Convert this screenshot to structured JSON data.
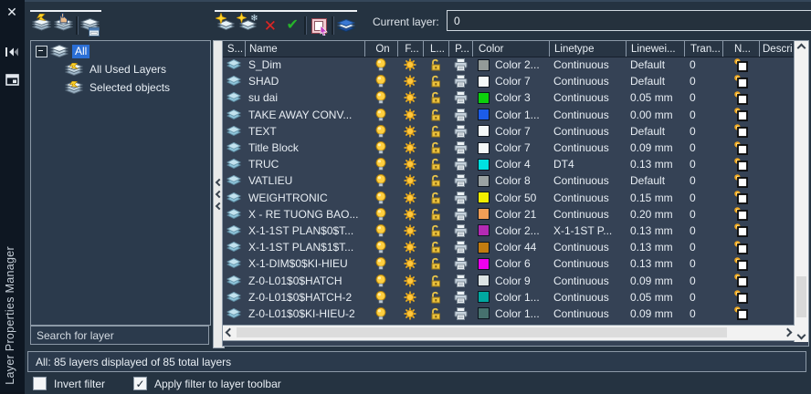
{
  "panel": {
    "title": "Layer Properties Manager",
    "accent_selection_color": "#2b6fd6"
  },
  "toolbar": {
    "left_icons": [
      "new-property-filter",
      "new-group-filter",
      "layer-states-manager"
    ],
    "right_icons": [
      "new-layer",
      "new-layer-vp-frozen",
      "delete-layer",
      "set-current",
      "select-layer",
      "layer-settings"
    ],
    "current_layer_label": "Current layer:",
    "current_layer_value": "0"
  },
  "side_icons": [
    "close-icon",
    "auto-hide-icon",
    "properties-menu-icon"
  ],
  "filters_tree": {
    "root": "All",
    "items": [
      "All Used Layers",
      "Selected objects"
    ]
  },
  "search": {
    "placeholder": "Search for layer"
  },
  "status_bar": "All: 85 layers displayed of 85 total layers",
  "footer": {
    "invert_filter": "Invert filter",
    "invert_checked": false,
    "apply_filter": "Apply filter to layer toolbar",
    "apply_checked": true,
    "check_glyph": "✓"
  },
  "table": {
    "columns": [
      "S...",
      "Name",
      "On",
      "F...",
      "L...",
      "P...",
      "Color",
      "Linetype",
      "Linewei...",
      "Tran...",
      "N...",
      "Descri"
    ],
    "rows": [
      {
        "name": "S_Dim",
        "color": "Color 2...",
        "hex": "#939a98",
        "linetype": "Continuous",
        "lineweight": "Default",
        "transparency": "0"
      },
      {
        "name": "SHAD",
        "color": "Color 7",
        "hex": "#f4f8f8",
        "linetype": "Continuous",
        "lineweight": "Default",
        "transparency": "0"
      },
      {
        "name": "su dai",
        "color": "Color 3",
        "hex": "#0cd00c",
        "linetype": "Continuous",
        "lineweight": "0.05 mm",
        "transparency": "0"
      },
      {
        "name": "TAKE AWAY CONV...",
        "color": "Color 1...",
        "hex": "#1c5ce8",
        "linetype": "Continuous",
        "lineweight": "0.00 mm",
        "transparency": "0"
      },
      {
        "name": "TEXT",
        "color": "Color 7",
        "hex": "#f4f8f8",
        "linetype": "Continuous",
        "lineweight": "Default",
        "transparency": "0"
      },
      {
        "name": "Title Block",
        "color": "Color 7",
        "hex": "#f4f8f8",
        "linetype": "Continuous",
        "lineweight": "0.09 mm",
        "transparency": "0"
      },
      {
        "name": "TRUC",
        "color": "Color 4",
        "hex": "#00e0e0",
        "linetype": "DT4",
        "lineweight": "0.13 mm",
        "transparency": "0"
      },
      {
        "name": "VATLIEU",
        "color": "Color 8",
        "hex": "#9aa2a2",
        "linetype": "Continuous",
        "lineweight": "Default",
        "transparency": "0"
      },
      {
        "name": "WEIGHTRONIC",
        "color": "Color 50",
        "hex": "#f2ee00",
        "linetype": "Continuous",
        "lineweight": "0.15 mm",
        "transparency": "0"
      },
      {
        "name": "X - RE TUONG BAO...",
        "color": "Color 21",
        "hex": "#f09e56",
        "linetype": "Continuous",
        "lineweight": "0.20 mm",
        "transparency": "0"
      },
      {
        "name": "X-1-1ST PLAN$0$T...",
        "color": "Color 2...",
        "hex": "#b32ab3",
        "linetype": "X-1-1ST P...",
        "lineweight": "0.13 mm",
        "transparency": "0"
      },
      {
        "name": "X-1-1ST PLAN$1$T...",
        "color": "Color 44",
        "hex": "#c27c10",
        "linetype": "Continuous",
        "lineweight": "0.13 mm",
        "transparency": "0"
      },
      {
        "name": "X-1-DIM$0$KI-HIEU",
        "color": "Color 6",
        "hex": "#ee00ee",
        "linetype": "Continuous",
        "lineweight": "0.13 mm",
        "transparency": "0"
      },
      {
        "name": "Z-0-L01$0$HATCH",
        "color": "Color 9",
        "hex": "#dce4e4",
        "linetype": "Continuous",
        "lineweight": "0.09 mm",
        "transparency": "0"
      },
      {
        "name": "Z-0-L01$0$HATCH-2",
        "color": "Color 1...",
        "hex": "#00a8a0",
        "linetype": "Continuous",
        "lineweight": "0.05 mm",
        "transparency": "0"
      },
      {
        "name": "Z-0-L01$0$KI-HIEU-2",
        "color": "Color 1...",
        "hex": "#46716e",
        "linetype": "Continuous",
        "lineweight": "0.09 mm",
        "transparency": "0"
      }
    ]
  }
}
